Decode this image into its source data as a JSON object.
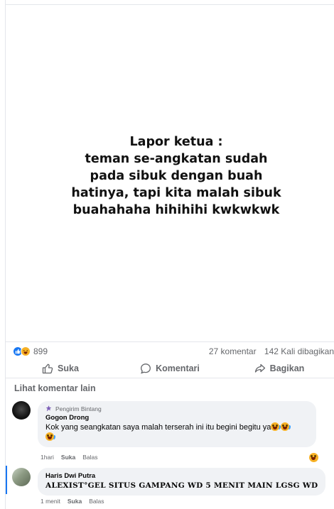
{
  "post": {
    "quote_text": "Lapor ketua :\nteman se-angkatan sudah\npada sibuk dengan buah\nhatinya, tapi kita malah sibuk\nbuahahaha hihihihi kwkwkwk"
  },
  "stats": {
    "reaction_count": "899",
    "comments": "27 komentar",
    "shares": "142 Kali dibagikan",
    "reactions": [
      "like",
      "haha"
    ],
    "colors": {
      "like": "#1877f2",
      "haha": "#f7b125"
    }
  },
  "actions": {
    "like": "Suka",
    "comment": "Komentari",
    "share": "Bagikan"
  },
  "more_comments": "Lihat komentar lain",
  "comments": [
    {
      "badge": "Pengirim Bintang",
      "author": "Gogon Drong",
      "text": "Kok yang seangkatan saya malah terserah ini itu begini begitu ya",
      "time": "1hari",
      "like": "Suka",
      "reply": "Balas",
      "avatar_icon": "avatar-dark"
    },
    {
      "author": "Haris Dwi Putra",
      "text": "ALEXIST°GEL SITUS GAMPANG WD 5 MENIT MAIN LGSG WD",
      "time": "1 menit",
      "like": "Suka",
      "reply": "Balas",
      "avatar_icon": "avatar-photo"
    }
  ]
}
